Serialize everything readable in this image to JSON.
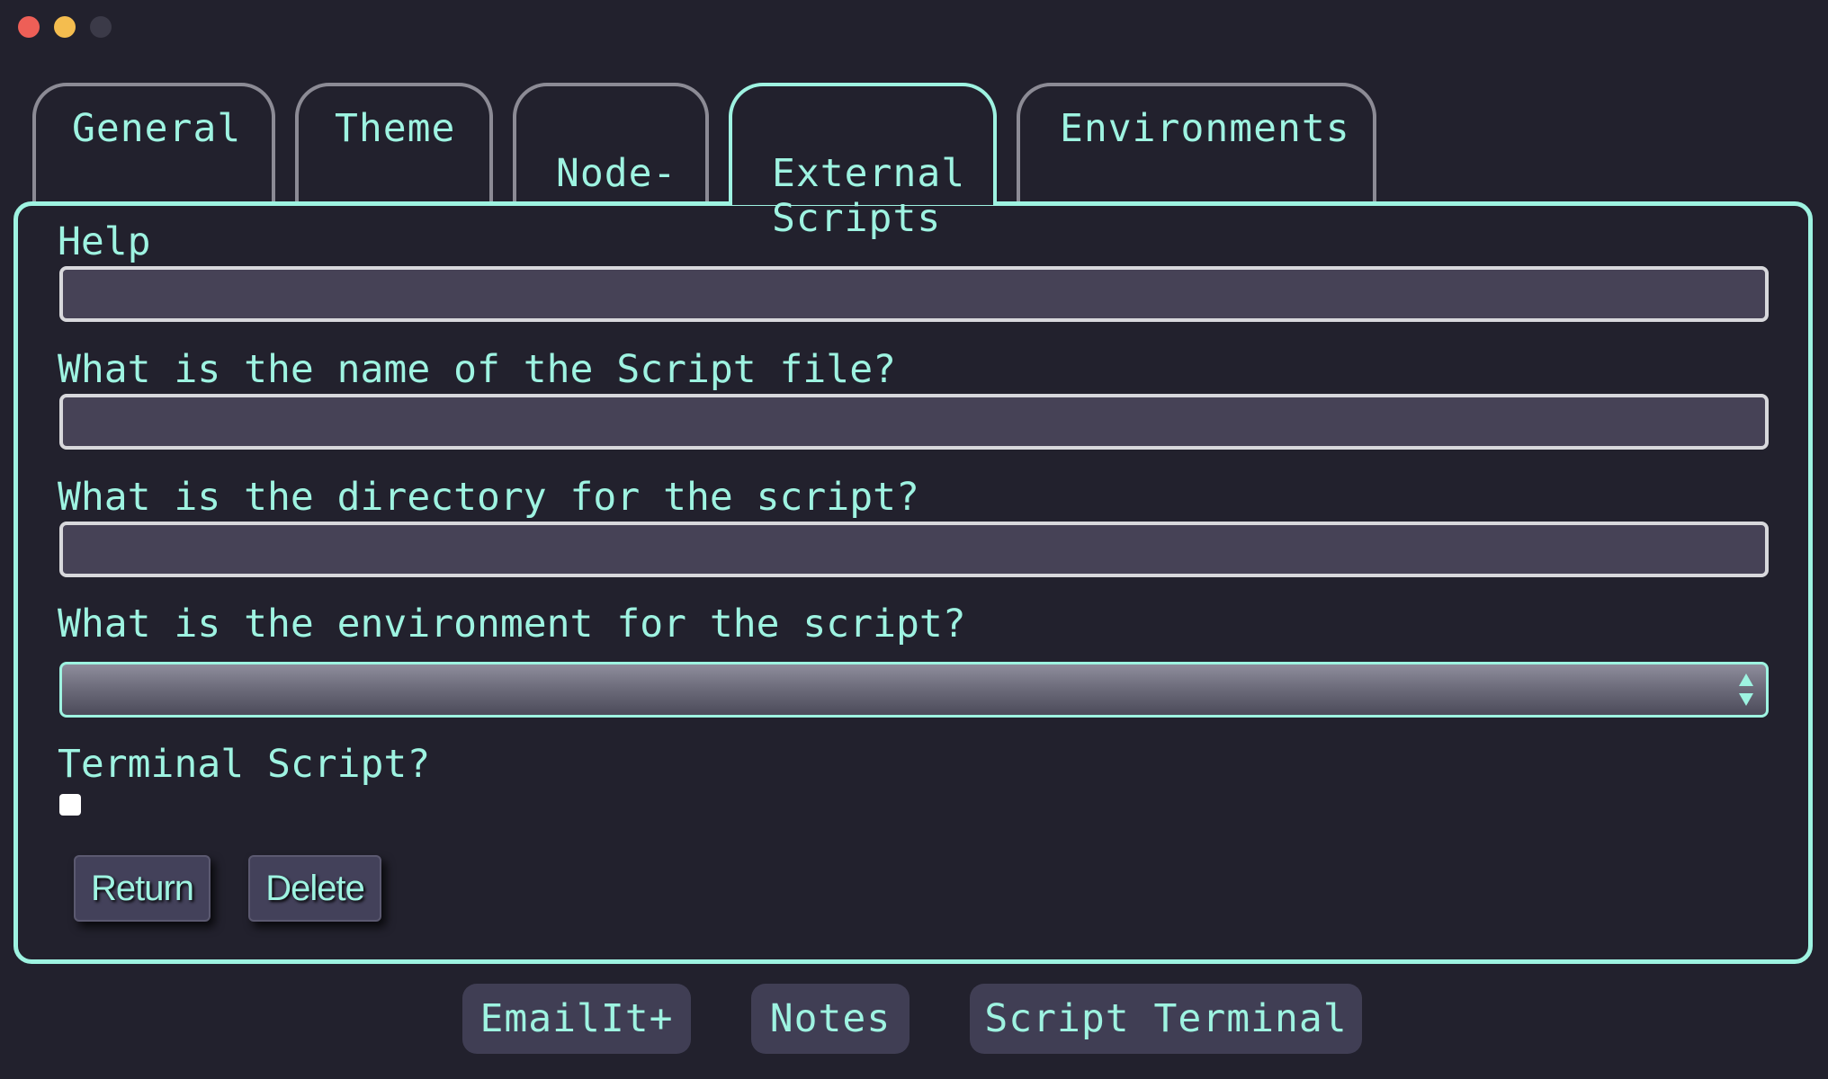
{
  "window": {
    "controls": [
      "close",
      "minimize",
      "maximize"
    ]
  },
  "tabs": [
    {
      "label": "General",
      "active": false
    },
    {
      "label": "Theme",
      "active": false
    },
    {
      "label": "Node-\nRed",
      "active": false
    },
    {
      "label": "External\nScripts",
      "active": true
    },
    {
      "label": "Environments",
      "active": false
    }
  ],
  "form": {
    "help_label": "Help",
    "help_value": "",
    "script_name_label": "What is the name of the Script file?",
    "script_name_value": "",
    "directory_label": "What is the directory for the script?",
    "directory_value": "",
    "environment_label": "What is the environment for the script?",
    "environment_value": "",
    "terminal_label": "Terminal Script?",
    "terminal_checked": false
  },
  "actions": {
    "return_label": "Return",
    "delete_label": "Delete"
  },
  "bottom": {
    "emailit_label": "EmailIt+",
    "notes_label": "Notes",
    "script_terminal_label": "Script Terminal"
  },
  "colors": {
    "accent": "#9ef3e1",
    "background": "#22212d",
    "field": "#464256",
    "button": "#403e54"
  }
}
